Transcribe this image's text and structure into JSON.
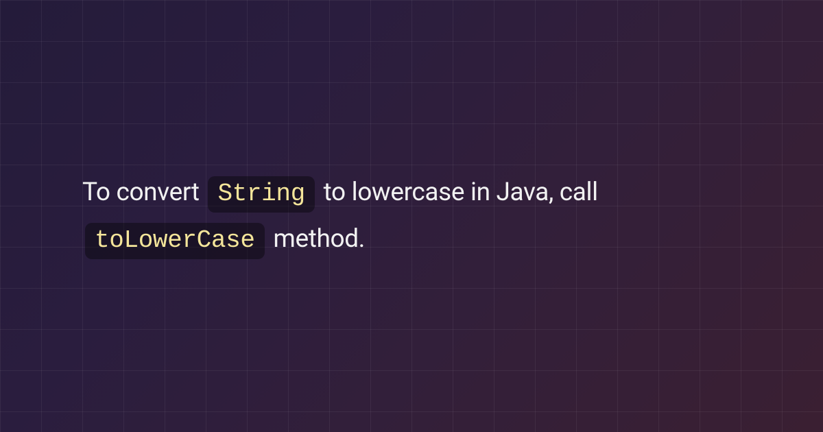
{
  "sentence": {
    "part1": "To convert ",
    "code1": "String",
    "part2": " to lowercase in Java, call ",
    "code2": "toLowerCase",
    "part3": " method."
  }
}
